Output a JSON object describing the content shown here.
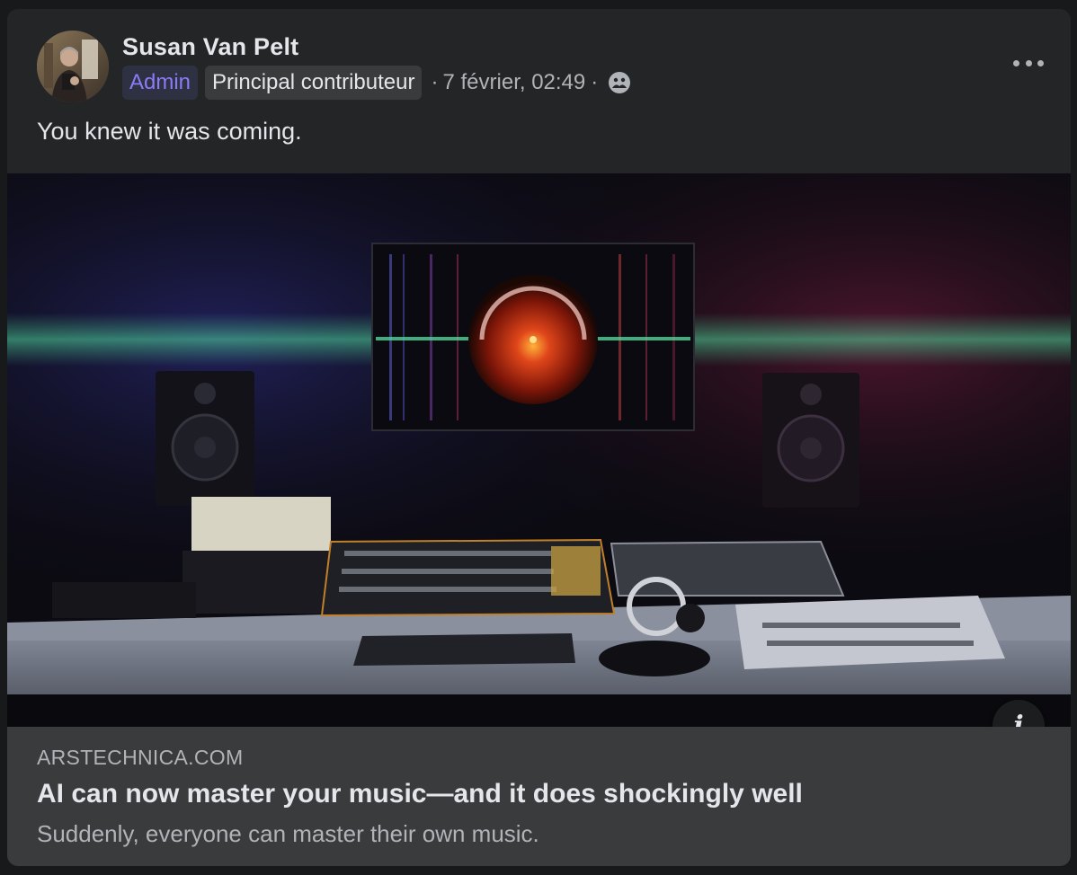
{
  "post": {
    "author": "Susan Van Pelt",
    "badges": [
      "Admin",
      "Principal contributeur"
    ],
    "timestamp": "7 février, 02:49",
    "separator": "·",
    "audience_icon": "group-icon",
    "more_icon": "more-options-icon",
    "text": "You knew it was coming."
  },
  "link_preview": {
    "domain": "ARSTECHNICA.COM",
    "title": "AI can now master your music—and it does shockingly well",
    "description": "Suddenly, everyone can master their own music.",
    "info_icon": "info-icon",
    "info_glyph": "i"
  },
  "colors": {
    "background": "#18191a",
    "card": "#242526",
    "link_box": "#3a3b3c",
    "admin_badge_text": "#8b7cf6",
    "secondary_text": "#b0b3b8"
  }
}
